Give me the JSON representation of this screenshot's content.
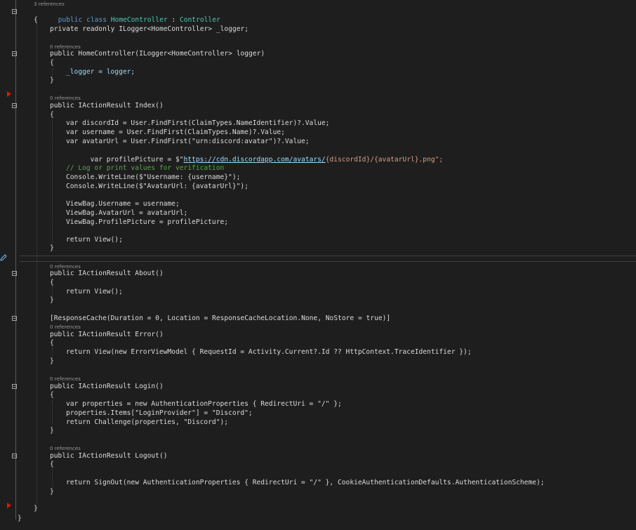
{
  "codelens": {
    "class_refs": "3 references",
    "zero_refs": "0 references"
  },
  "lines": {
    "class_decl": [
      "public",
      "class",
      "HomeController",
      ":",
      "Controller"
    ],
    "open_brace": "{",
    "close_brace": "}"
  },
  "code": {
    "l_logger_field": "private readonly ILogger<HomeController> _logger;",
    "l_ctor": "public HomeController(ILogger<HomeController> logger)",
    "l_ctor_body": "_logger = logger;",
    "l_index": "public IActionResult Index()",
    "l_discordId": "var discordId = User.FindFirst(ClaimTypes.NameIdentifier)?.Value;",
    "l_username": "var username = User.FindFirst(ClaimTypes.Name)?.Value;",
    "l_avatarUrl": "var avatarUrl = User.FindFirst(\"urn:discord:avatar\")?.Value;",
    "l_profilePicture_pre": "var profilePicture = $\"",
    "l_profilePicture_url": "https://cdn.discordapp.com/avatars/",
    "l_profilePicture_post": "{discordId}/{avatarUrl}.png\";",
    "l_comment": "// Log or print values for verification",
    "l_console1": "Console.WriteLine($\"Username: {username}\");",
    "l_console2": "Console.WriteLine($\"AvatarUrl: {avatarUrl}\");",
    "l_vb1": "ViewBag.Username = username;",
    "l_vb2": "ViewBag.AvatarUrl = avatarUrl;",
    "l_vb3": "ViewBag.ProfilePicture = profilePicture;",
    "l_return_view": "return View();",
    "l_about": "public IActionResult About()",
    "l_attr": "[ResponseCache(Duration = 0, Location = ResponseCacheLocation.None, NoStore = true)]",
    "l_error": "public IActionResult Error()",
    "l_error_ret": "return View(new ErrorViewModel { RequestId = Activity.Current?.Id ?? HttpContext.TraceIdentifier });",
    "l_login": "public IActionResult Login()",
    "l_login_props": "var properties = new AuthenticationProperties { RedirectUri = \"/\" };",
    "l_login_items": "properties.Items[\"LoginProvider\"] = \"Discord\";",
    "l_login_ret": "return Challenge(properties, \"Discord\");",
    "l_logout": "public IActionResult Logout()",
    "l_logout_ret": "return SignOut(new AuthenticationProperties { RedirectUri = \"/\" }, CookieAuthenticationDefaults.AuthenticationScheme);"
  },
  "colors": {
    "background": "#1e1e1e",
    "keyword": "#569cd6",
    "type": "#4ec9b0",
    "method": "#dcdcaa",
    "variable": "#9cdcfe",
    "string": "#d69d85",
    "comment": "#57a64a",
    "breakpoint_arrow": "#e51400"
  }
}
